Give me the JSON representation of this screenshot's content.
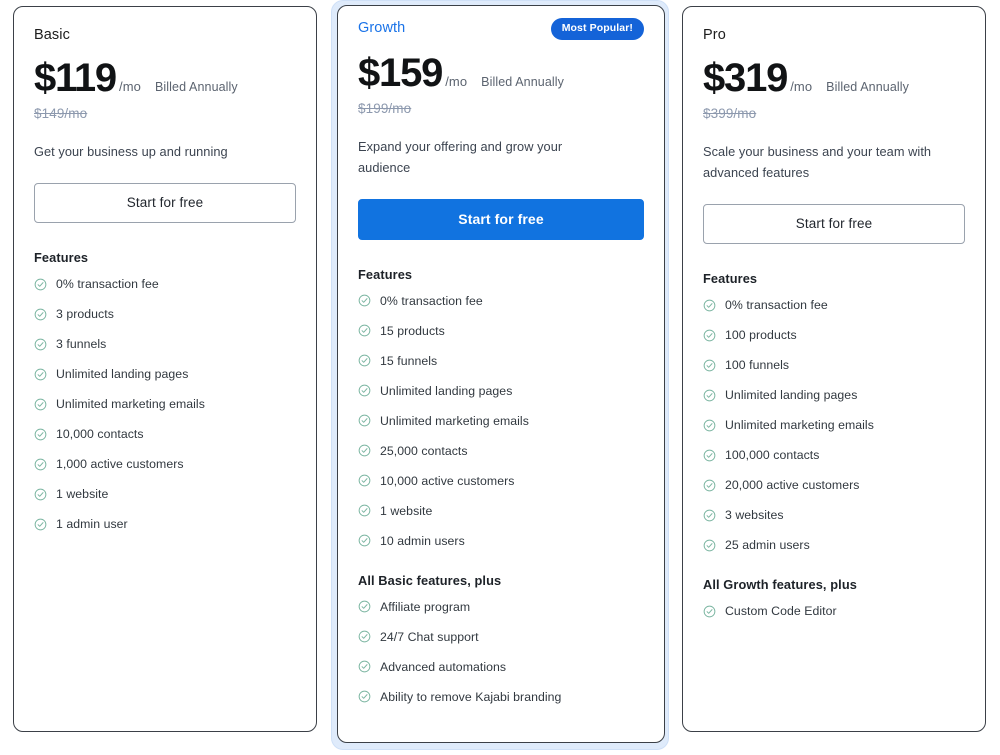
{
  "accent_color": "#1173e0",
  "badge_color": "#1463d8",
  "check_color": "#7cb6a2",
  "plans": [
    {
      "name": "Basic",
      "badge": null,
      "price": "$119",
      "per": "/mo",
      "billed": "Billed Annually",
      "old_price": "$149/mo",
      "description": "Get your business up and running",
      "cta": "Start for free",
      "features_title": "Features",
      "features": [
        "0% transaction fee",
        "3 products",
        "3 funnels",
        "Unlimited landing pages",
        "Unlimited marketing emails",
        "10,000 contacts",
        "1,000 active customers",
        "1 website",
        "1 admin user"
      ],
      "extra_title": null,
      "extra_features": []
    },
    {
      "name": "Growth",
      "badge": "Most Popular!",
      "price": "$159",
      "per": "/mo",
      "billed": "Billed Annually",
      "old_price": "$199/mo",
      "description": "Expand your offering and grow your audience",
      "cta": "Start for free",
      "features_title": "Features",
      "features": [
        "0% transaction fee",
        "15 products",
        "15 funnels",
        "Unlimited landing pages",
        "Unlimited marketing emails",
        "25,000 contacts",
        "10,000 active customers",
        "1 website",
        "10 admin users"
      ],
      "extra_title": "All Basic features, plus",
      "extra_features": [
        "Affiliate program",
        "24/7 Chat support",
        "Advanced automations",
        "Ability to remove Kajabi branding"
      ]
    },
    {
      "name": "Pro",
      "badge": null,
      "price": "$319",
      "per": "/mo",
      "billed": "Billed Annually",
      "old_price": "$399/mo",
      "description": "Scale your business and your team with advanced features",
      "cta": "Start for free",
      "features_title": "Features",
      "features": [
        "0% transaction fee",
        "100 products",
        "100 funnels",
        "Unlimited landing pages",
        "Unlimited marketing emails",
        "100,000 contacts",
        "20,000 active customers",
        "3 websites",
        "25 admin users"
      ],
      "extra_title": "All Growth features, plus",
      "extra_features": [
        "Custom Code Editor"
      ]
    }
  ]
}
